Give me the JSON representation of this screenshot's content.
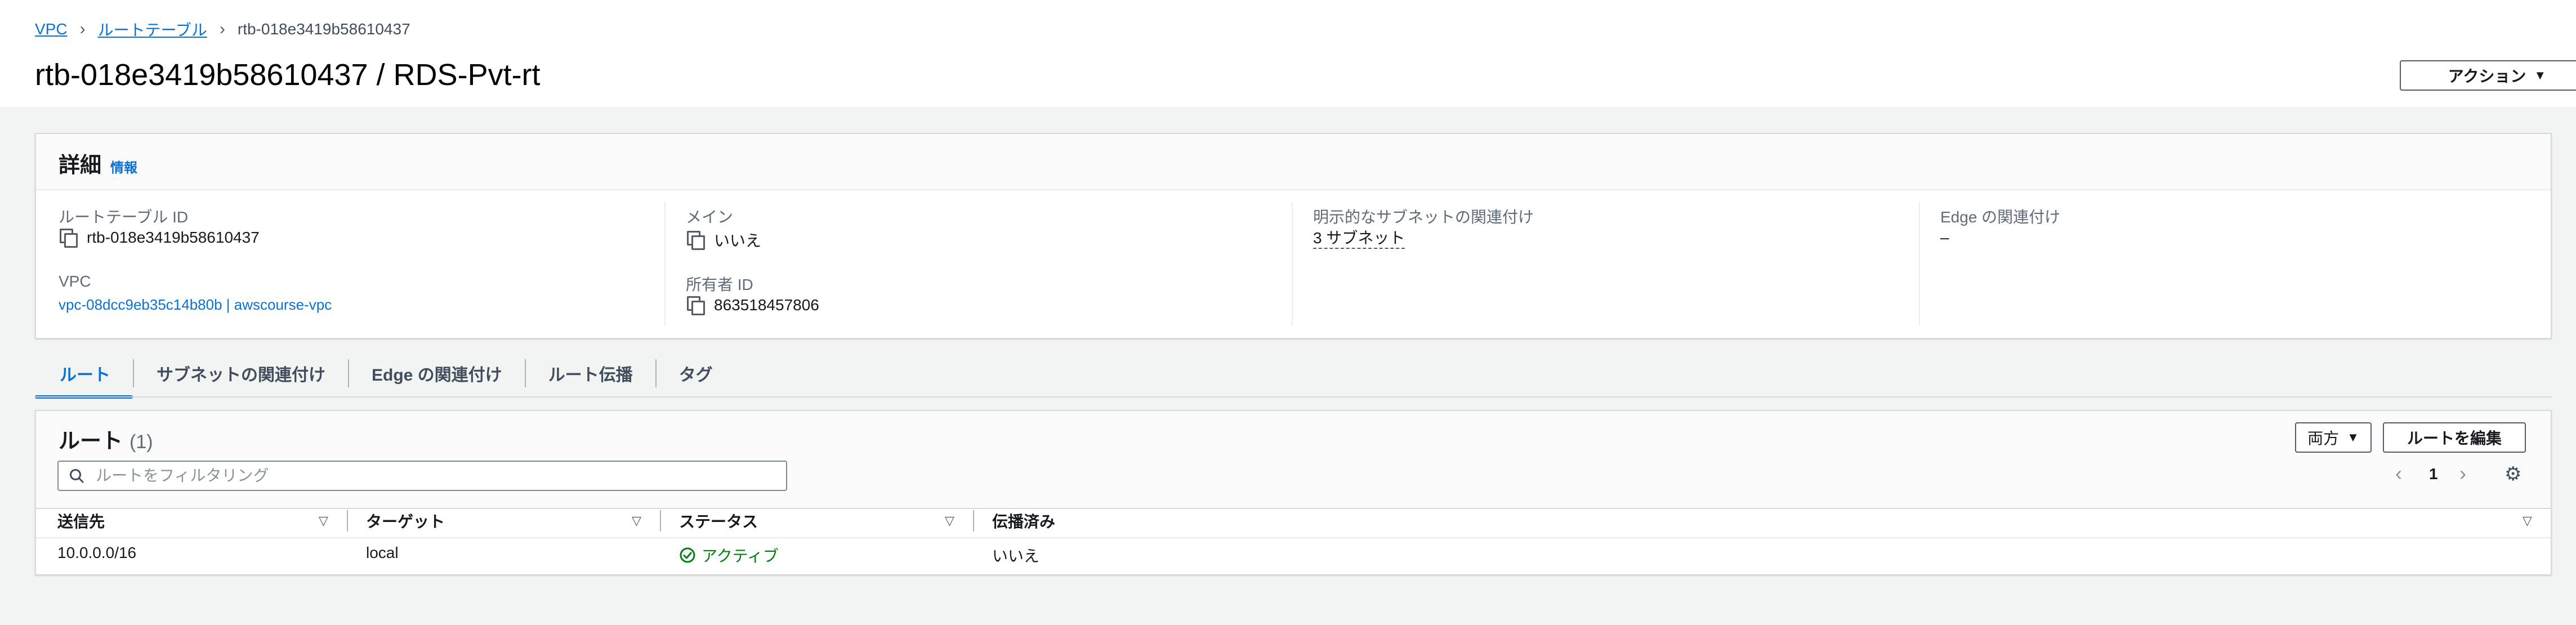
{
  "breadcrumb": {
    "vpc": "VPC",
    "route_tables": "ルートテーブル",
    "current": "rtb-018e3419b58610437"
  },
  "page_title": "rtb-018e3419b58610437 / RDS-Pvt-rt",
  "actions_button": "アクション",
  "details": {
    "title": "詳細",
    "info": "情報",
    "route_table_id_label": "ルートテーブル ID",
    "route_table_id": "rtb-018e3419b58610437",
    "main_label": "メイン",
    "main_value": "いいえ",
    "explicit_subnet_label": "明示的なサブネットの関連付け",
    "explicit_subnet_value": "3 サブネット",
    "edge_label": "Edge の関連付け",
    "edge_value": "–",
    "vpc_label": "VPC",
    "vpc_value": "vpc-08dcc9eb35c14b80b | awscourse-vpc",
    "owner_label": "所有者 ID",
    "owner_value": "863518457806"
  },
  "tabs": [
    "ルート",
    "サブネットの関連付け",
    "Edge の関連付け",
    "ルート伝播",
    "タグ"
  ],
  "routes": {
    "title": "ルート",
    "count": "(1)",
    "filter_select": "両方",
    "edit_button": "ルートを編集",
    "search_placeholder": "ルートをフィルタリング",
    "page_number": "1",
    "columns": [
      "送信先",
      "ターゲット",
      "ステータス",
      "伝播済み"
    ],
    "rows": [
      {
        "destination": "10.0.0.0/16",
        "target": "local",
        "status": "アクティブ",
        "propagated": "いいえ"
      }
    ]
  },
  "colors": {
    "link": "#0972d3",
    "success": "#037f0c",
    "background": "#f2f3f3"
  },
  "icons": [
    "chevron-right-icon",
    "copy-icon",
    "search-icon",
    "chevron-left-icon",
    "gear-icon",
    "check-circle-icon",
    "sort-down-icon"
  ]
}
